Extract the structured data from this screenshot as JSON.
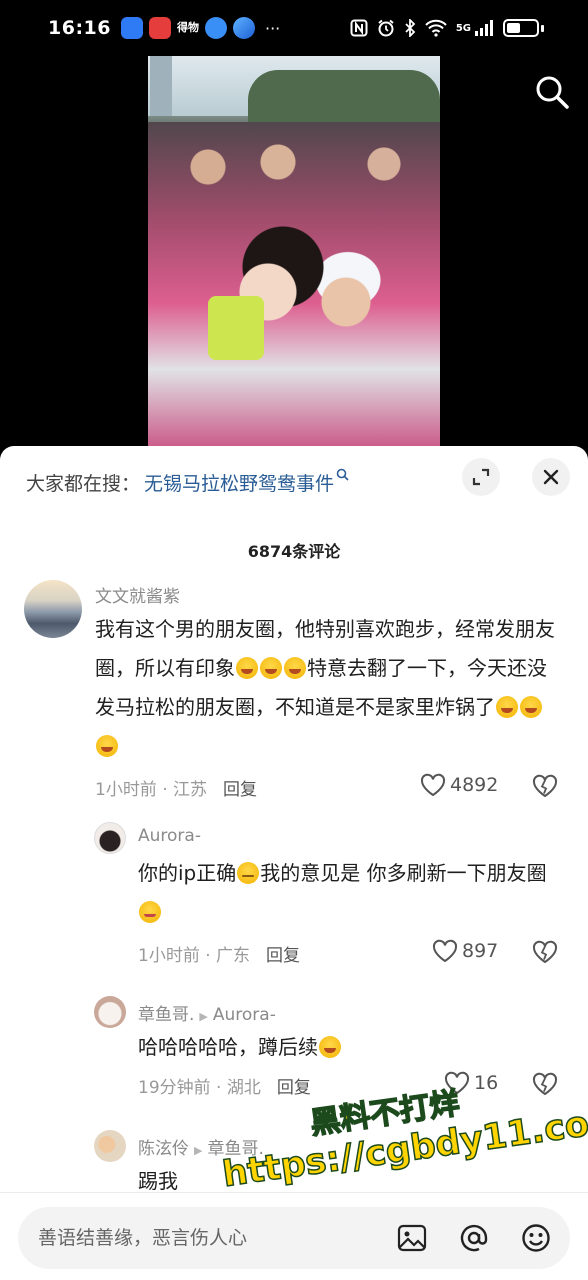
{
  "status_bar": {
    "time": "16:16",
    "notification_icons": [
      "messages-icon",
      "app-red-icon",
      "text-app-icon",
      "baidu-icon",
      "browser-icon"
    ],
    "text_app_label": "得物",
    "more": "···",
    "network": "5G"
  },
  "video": {
    "search_icon": "search-icon"
  },
  "hot_search": {
    "prefix": "大家都在搜：",
    "query": "无锡马拉松野鸳鸯事件",
    "icon": "search-small-icon"
  },
  "comments_header": {
    "count_label": "6874条评论"
  },
  "comments": [
    {
      "username": "文文就酱紫",
      "text_part1": "我有这个男的朋友圈，他特别喜欢跑步，经常发朋友圈，所以有印象",
      "text_part2": "特意去翻了一下，今天还没发马拉松的朋友圈，不知道是不是家里炸锅了",
      "time_location": "1小时前 · 江苏",
      "reply_label": "回复",
      "likes": "4892"
    },
    {
      "username": "Aurora-",
      "text_part1": "你的ip正确",
      "text_part2": "我的意见是 你多刷新一下朋友圈",
      "time_location": "1小时前 · 广东",
      "reply_label": "回复",
      "likes": "897"
    },
    {
      "username": "章鱼哥.",
      "reply_to": "Aurora-",
      "text": "哈哈哈哈哈，蹲后续",
      "time_location": "19分钟前 · 湖北",
      "reply_label": "回复",
      "likes": "16"
    },
    {
      "username": "陈泫伶",
      "reply_to": "章鱼哥.",
      "text": "踢我"
    }
  ],
  "watermark": {
    "line1": "黑料不打烊",
    "line2": "https://cgbdy11.com"
  },
  "input": {
    "placeholder": "善语结善缘，恶言伤人心"
  },
  "colors": {
    "link_blue": "#2a5c95",
    "watermark_yellow": "#ffd400"
  }
}
